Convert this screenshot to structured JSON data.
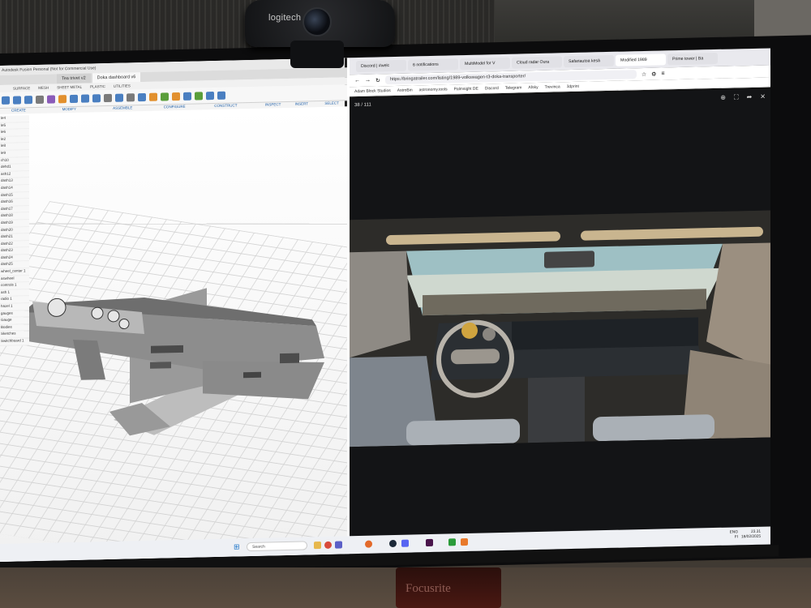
{
  "webcam": {
    "brand": "logitech"
  },
  "fusion": {
    "window_title": "Autodesk Fusion Personal (Not for Commercial Use)",
    "tabs": [
      "Tea trivet v2",
      "Doka dashboard v6"
    ],
    "mode_tabs": [
      "SURFACE",
      "MESH",
      "SHEET METAL",
      "PLASTIC",
      "UTILITIES"
    ],
    "tool_groups": [
      "CREATE",
      "MODIFY",
      "ASSEMBLE",
      "CONFIGURE",
      "CONSTRUCT",
      "INSPECT",
      "INSERT",
      "SELECT"
    ],
    "browser_items": [
      "le4",
      "le5",
      "le6",
      "le2",
      "le8",
      "le9",
      "ch10",
      "dehd1",
      "ash12",
      "dash13",
      "dash14",
      "dash15",
      "dash16",
      "dash17",
      "dash18",
      "dash19",
      "dash20",
      "dash21",
      "dash22",
      "dash23",
      "dash24",
      "dash25",
      "wheel_center 1",
      "aswheel",
      "controls 1",
      "ash 1",
      "radio 1",
      "hazel 1",
      "gauges",
      "Gauge",
      "Bodies",
      "Sketches",
      "Switchboard 1"
    ]
  },
  "firefox": {
    "tabs": [
      "Discord | #welc",
      "6 notifications",
      "MultiModel for V",
      "Cloud radar Oura",
      "Safariautoa kesä",
      "Modified 1989",
      "Prime tower | Ba"
    ],
    "active_tab": 5,
    "url": "https://bringatrailer.com/listing/1989-volkswagen-t3-doka-transporter/",
    "bookmarks": [
      "Adam Block Studios",
      "AstroBin",
      "astronomy.tools",
      "Palmsight DE",
      "Discord",
      "Telegram",
      "Afsky",
      "Trevinca",
      "3dprint"
    ],
    "gallery_counter": "38 / 111"
  },
  "taskbar": {
    "search_placeholder": "Search",
    "lang": "ENG",
    "region": "FI",
    "time": "23.31",
    "date": "18/02/2025"
  },
  "desk": {
    "device_brand": "Focusrite"
  }
}
